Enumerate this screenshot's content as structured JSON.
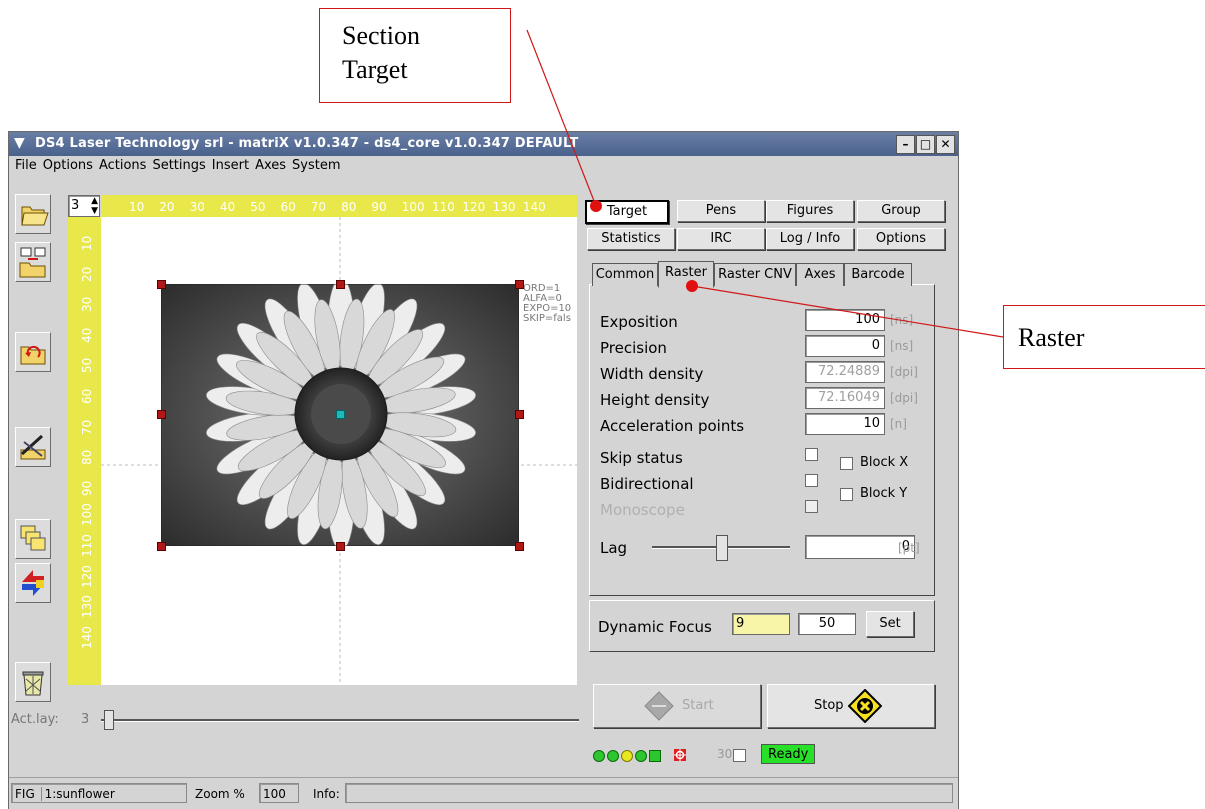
{
  "callouts": {
    "section_target": "Section\nTarget",
    "raster": "Raster"
  },
  "window": {
    "title": "DS4 Laser Technology srl - matriX v1.0.347 - ds4_core v1.0.347   DEFAULT",
    "controls": {
      "minimize": "–",
      "maximize": "□",
      "close": "✕"
    }
  },
  "menu": [
    "File",
    "Options",
    "Actions",
    "Settings",
    "Insert",
    "Axes",
    "System"
  ],
  "toolbar": {
    "layer_spin_value": "3",
    "icons": [
      "open-folder-icon",
      "import-icon",
      "reload-icon",
      "edit-icon",
      "copy-icon",
      "refresh-icon",
      "trash-icon"
    ]
  },
  "ruler": {
    "top": [
      "10",
      "20",
      "30",
      "40",
      "50",
      "60",
      "70",
      "80",
      "90",
      "100",
      "110",
      "120",
      "130",
      "140"
    ],
    "left": [
      "10",
      "20",
      "30",
      "40",
      "50",
      "60",
      "70",
      "80",
      "90",
      "100",
      "110",
      "120",
      "130",
      "140"
    ]
  },
  "figure": {
    "info": [
      "ORD=1",
      "ALFA=0",
      "EXPO=10",
      "SKIP=fals"
    ]
  },
  "act_layer": {
    "label": "Act.lay:",
    "value": "3"
  },
  "section_buttons": [
    "Target",
    "Pens",
    "Figures",
    "Group",
    "Statistics",
    "IRC",
    "Log / Info",
    "Options"
  ],
  "tabs": [
    "Common",
    "Raster",
    "Raster CNV",
    "Axes",
    "Barcode"
  ],
  "raster": {
    "rows": [
      {
        "label": "Exposition",
        "value": "100",
        "unit": "[ns]",
        "disabled": false
      },
      {
        "label": "Precision",
        "value": "0",
        "unit": "[ns]",
        "disabled": false
      },
      {
        "label": "Width density",
        "value": "72.24889",
        "unit": "[dpi]",
        "disabled": true
      },
      {
        "label": "Height density",
        "value": "72.16049",
        "unit": "[dpi]",
        "disabled": true
      },
      {
        "label": "Acceleration points",
        "value": "10",
        "unit": "[n]",
        "disabled": false
      }
    ],
    "checks": [
      "Skip status",
      "Bidirectional",
      "Monoscope"
    ],
    "block_x": "Block X",
    "block_y": "Block Y",
    "lag_label": "Lag",
    "lag_value": "0",
    "lag_unit": "[pt]"
  },
  "dynamic_focus": {
    "label": "Dynamic Focus",
    "value1": "9",
    "value2": "50",
    "set_label": "Set"
  },
  "actions": {
    "start": "Start",
    "stop": "Stop"
  },
  "status_indicators": {
    "count": "30",
    "ready": "Ready"
  },
  "statusbar": {
    "fig_label": "FIG",
    "fig_value": "1:sunflower",
    "zoom_label": "Zoom %",
    "zoom_value": "100",
    "info_label": "Info:"
  },
  "colors": {
    "ruler": "#e8e84a",
    "ready": "#27e027",
    "focus_field": "#f8f4a8",
    "callout_border": "#d01818"
  }
}
